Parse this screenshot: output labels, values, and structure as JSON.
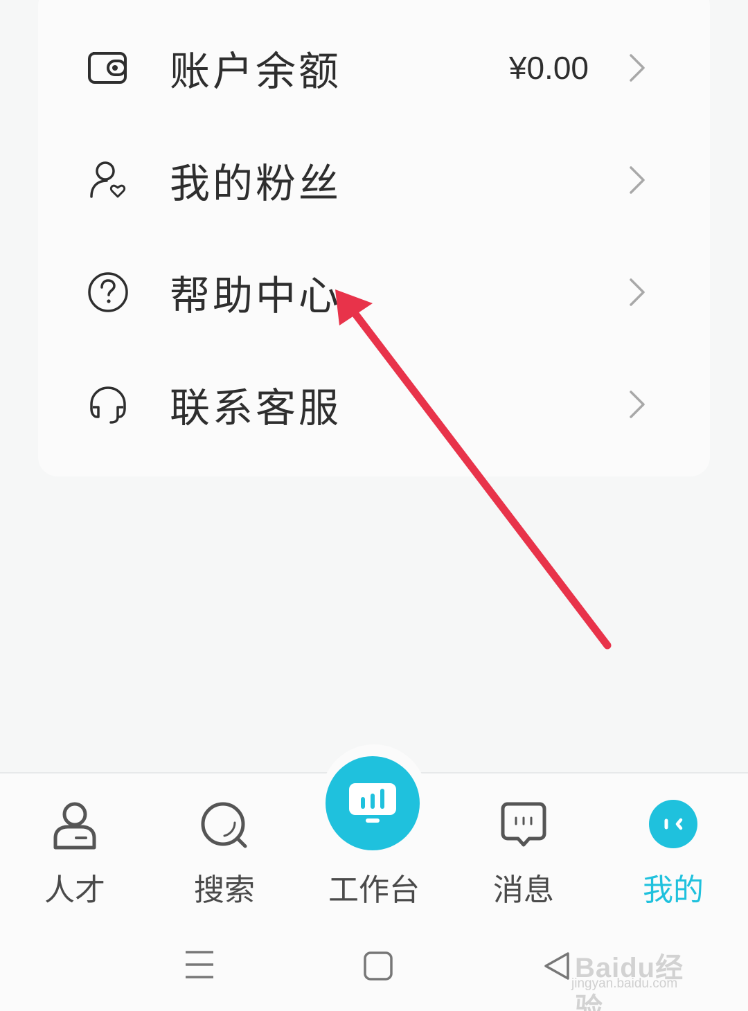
{
  "menu": {
    "items": [
      {
        "label": "账户余额",
        "value": "¥0.00",
        "icon": "wallet-icon"
      },
      {
        "label": "我的粉丝",
        "value": "",
        "icon": "fans-icon"
      },
      {
        "label": "帮助中心",
        "value": "",
        "icon": "help-icon"
      },
      {
        "label": "联系客服",
        "value": "",
        "icon": "headset-icon"
      }
    ]
  },
  "tabbar": {
    "tabs": [
      {
        "label": "人才",
        "icon": "person-icon",
        "active": false
      },
      {
        "label": "搜索",
        "icon": "search-icon",
        "active": false
      },
      {
        "label": "工作台",
        "icon": "dashboard-icon",
        "active": false
      },
      {
        "label": "消息",
        "icon": "message-icon",
        "active": false
      },
      {
        "label": "我的",
        "icon": "profile-icon",
        "active": true
      }
    ]
  },
  "watermark": {
    "logo": "Baidu经验",
    "url": "jingyan.baidu.com"
  },
  "colors": {
    "accent": "#1fc1dd",
    "annotation_arrow": "#e8334a",
    "background": "#f6f7f7"
  }
}
